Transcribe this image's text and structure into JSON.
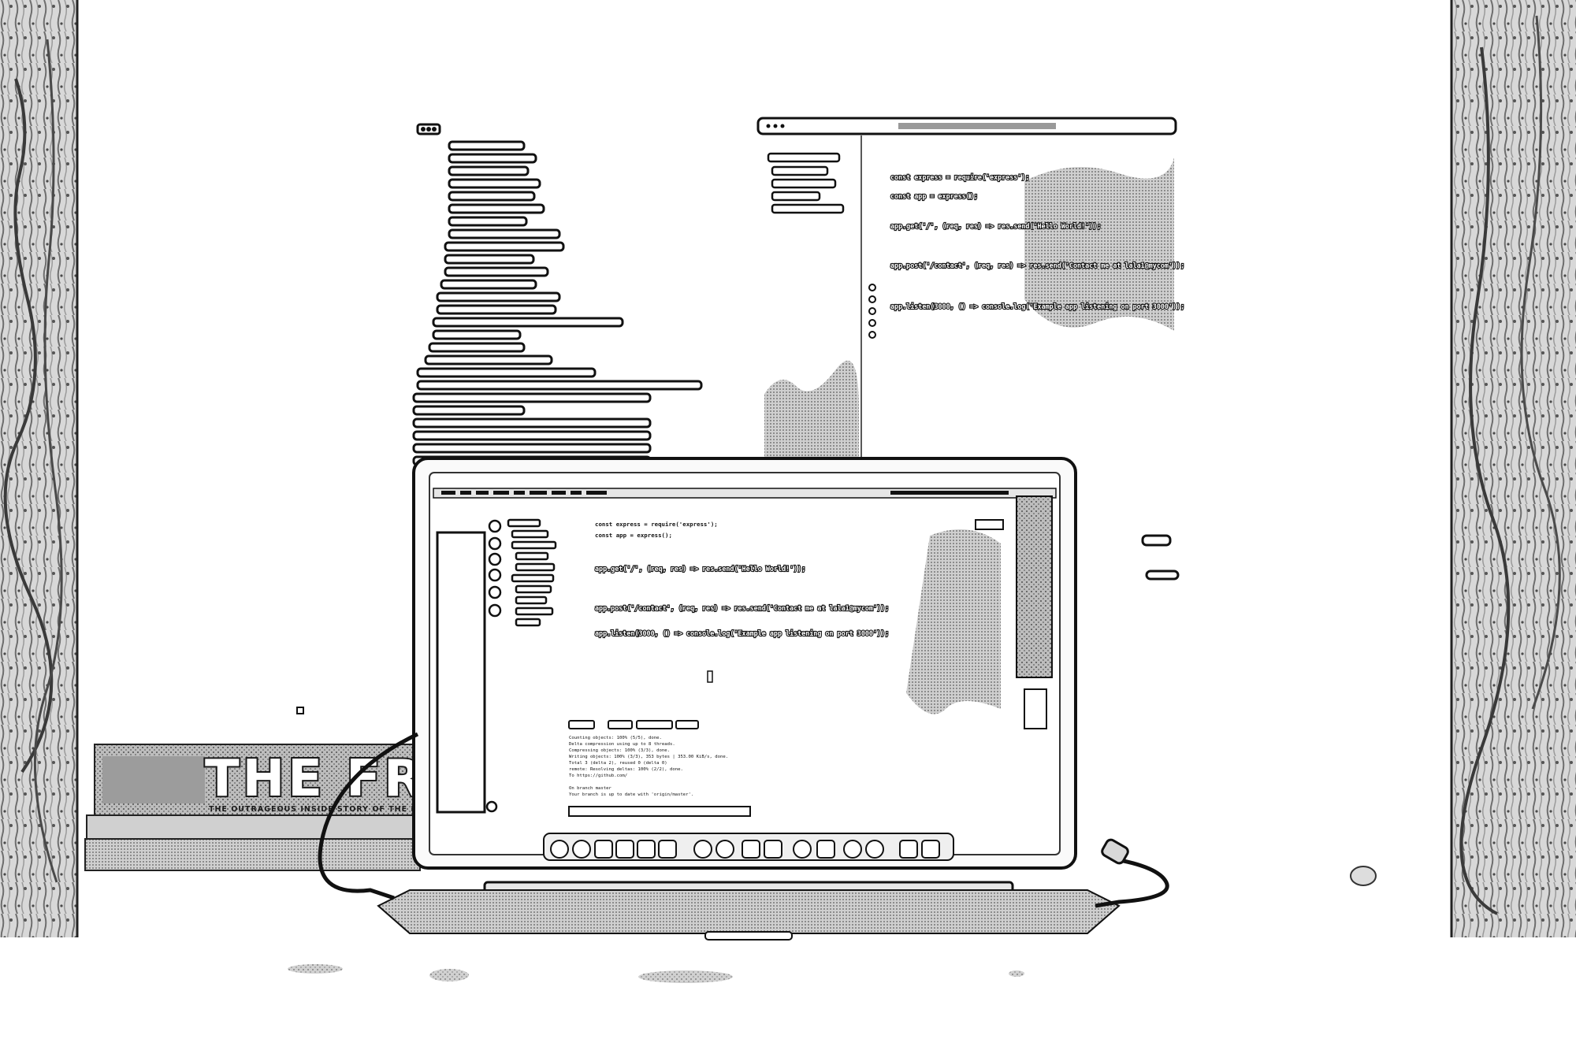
{
  "scene": {
    "description_tags": [
      "laptop",
      "code-editor",
      "book",
      "desk",
      "wooden-frame"
    ]
  },
  "book": {
    "title": "THE FRACKE",
    "subtitle": "THE OUTRAGEOUS INSIDE STORY OF THE NEW ENERGY"
  },
  "editor_window": {
    "code_lines": [
      "const express = require('express');",
      "const app = express();",
      "app.get('/', (req, res) => res.send('Hello World!'));",
      "app.post('/contact', (req, res) => res.send('Contact me at lala1@mycom'));",
      "app.listen(3000, () => console.log('Example app listening on port 3000'));"
    ]
  },
  "laptop_screen": {
    "code_lines": [
      "const express = require('express');",
      "const app = express();",
      "app.get('/', (req, res) => res.send('Hello World!'));",
      "app.post('/contact', (req, res) => res.send('Contact me at lala1@mycom'));",
      "app.listen(3000, () => console.log('Example app listening on port 3000'));"
    ],
    "terminal_lines": [
      "Counting objects: 100% (5/5), done.",
      "Delta compression using up to 8 threads.",
      "Compressing objects: 100% (3/3), done.",
      "Writing objects: 100% (3/3), 353 bytes | 353.00 KiB/s, done.",
      "Total 3 (delta 2), reused 0 (delta 0)",
      "remote: Resolving deltas: 100% (2/2), done.",
      "To https://github.com/",
      "On branch master",
      "Your branch is up to date with 'origin/master'."
    ]
  }
}
